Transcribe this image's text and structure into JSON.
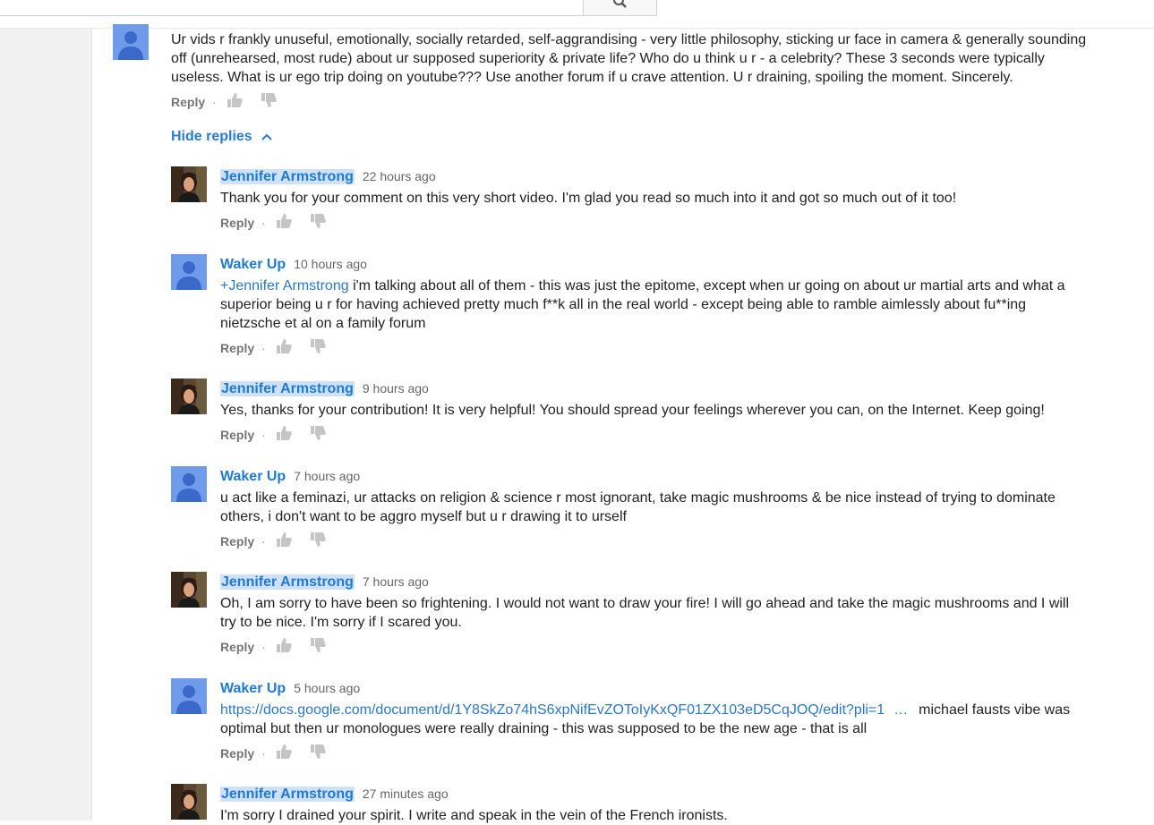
{
  "search": {
    "value": "",
    "placeholder": ""
  },
  "top_comment": {
    "text": "Ur vids r frankly unuseful, emotionally, socially retarded, self-aggrandising - very little philosophy, sticking ur face in camera & generally sounding off (unrehearsed, most rude) about ur supposed superiority & private life? Who do u think u r - a celebrity? These 3 seconds were typically useless. What is ur ego trip doing on youtube??? Use another forum if u crave attention. U r draining, spoiling the moment. Sincerely.",
    "reply_label": "Reply"
  },
  "hide_replies_label": "Hide replies",
  "replies": [
    {
      "author": "Jennifer Armstrong",
      "time": "22 hours ago",
      "text": "Thank you for your comment on this very short video.  I'm glad you read so much into it and got so much out of it too!",
      "reply_label": "Reply"
    },
    {
      "author": "Waker Up",
      "time": "10 hours ago",
      "mention": "+Jennifer Armstrong",
      "text": " i'm talking about all of them - this was just the epitome, except when ur going on about ur martial arts and what a superior being u r for having achieved pretty much f**k all in the real world - except being able to ramble aimlessly about fu**ing nietzsche et al on a family forum",
      "reply_label": "Reply"
    },
    {
      "author": "Jennifer Armstrong",
      "time": "9 hours ago",
      "text": "Yes, thanks for your contribution!  It is very helpful!  You should spread your feelings wherever you can, on the Internet.  Keep going!",
      "reply_label": "Reply"
    },
    {
      "author": "Waker Up",
      "time": "7 hours ago",
      "text": "u act like a feminazi, ur attacks on religion & science r most ignorant, take magic mushrooms & be nice instead of trying to dominate others, i don't want to be aggro myself but u r drawing it to urself",
      "reply_label": "Reply"
    },
    {
      "author": "Jennifer Armstrong",
      "time": "7 hours ago",
      "text": "Oh, I am sorry to have been so frightening.  I would not want to draw your fire!  I will go ahead and take the magic mushrooms and I will try to be nice.  I'm sorry if I scared you.",
      "reply_label": "Reply"
    },
    {
      "author": "Waker Up",
      "time": "5 hours ago",
      "link": "https://docs.google.com/document/d/1Y8SkZo74hS6xpNifEvZOToIyKxQF01ZX103eD5CqJOQ/edit?pli=1",
      "ellipsis": "…",
      "text": "michael fausts vibe was optimal but then ur monologues were really draining - this was supposed to be the new age - that is all",
      "reply_label": "Reply"
    },
    {
      "author": "Jennifer Armstrong",
      "time": "27 minutes ago",
      "text": "I'm sorry I drained your spirit.  I write and speak in the vein of the French ironists."
    }
  ],
  "colors": {
    "author_blue": "#1f7ad1",
    "author_highlight": "#cfe1f6",
    "link_blue": "#2a77c9",
    "default_avatar": "#6f9bea",
    "left_rail": "#f1f1f1"
  },
  "icons": [
    "search-icon",
    "thumbs-up-icon",
    "thumbs-down-icon",
    "chevron-up-icon",
    "default-user-avatar",
    "user-photo-avatar"
  ]
}
